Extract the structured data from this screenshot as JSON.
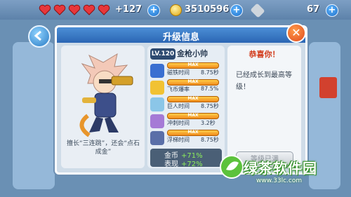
{
  "hud": {
    "hearts_count": 5,
    "hearts_plus": "+127",
    "coins": "3510596",
    "gems": "67"
  },
  "dialog": {
    "title": "升级信息",
    "close_label": "✕"
  },
  "hero": {
    "level": "LV.120",
    "name": "金枪小帅",
    "description": "擅长“三连跳”，还会“点石成金”"
  },
  "skills": [
    {
      "icon": "magnet-icon",
      "name": "磁铁时间",
      "value": "8.75秒",
      "max_label": "MAX"
    },
    {
      "icon": "wing-icon",
      "name": "飞币爆率",
      "value": "87.5%",
      "max_label": "MAX"
    },
    {
      "icon": "giant-icon",
      "name": "巨人时间",
      "value": "8.75秒",
      "max_label": "MAX"
    },
    {
      "icon": "dash-icon",
      "name": "冲刺时间",
      "value": "3.2秒",
      "max_label": "MAX"
    },
    {
      "icon": "float-icon",
      "name": "浮梯时间",
      "value": "8.75秒",
      "max_label": "MAX"
    }
  ],
  "gains": [
    {
      "label": "金币",
      "value": "+71%"
    },
    {
      "label": "表现",
      "value": "+72%"
    }
  ],
  "result": {
    "congrats": "恭喜你！",
    "message": "已经成长到最高等级！",
    "button_label": "等级已满"
  },
  "watermark": {
    "text": "绿茶软件园",
    "url": "www.33lc.com"
  },
  "colors": {
    "accent_blue": "#2b66b4",
    "max_bar": "#f08a1c",
    "gain_green": "#8ef05a",
    "congrats_red": "#d23a1a"
  }
}
